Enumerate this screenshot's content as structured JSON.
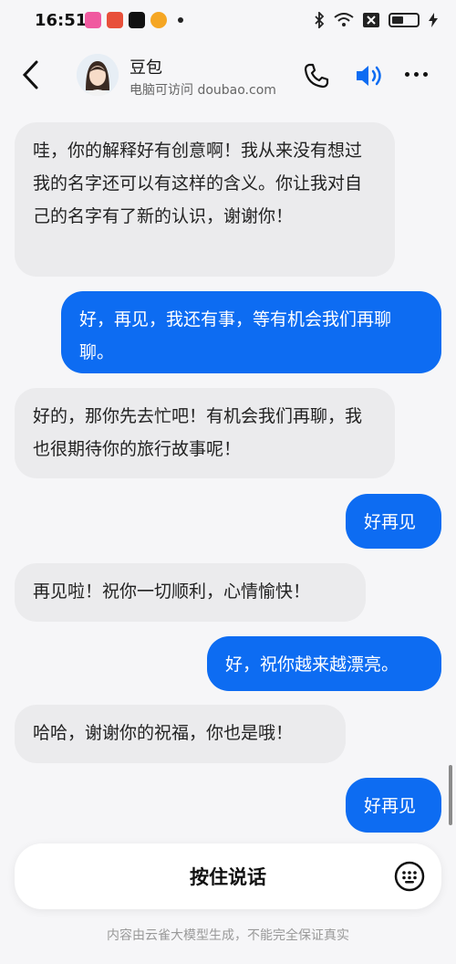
{
  "status_bar": {
    "time": "16:51"
  },
  "header": {
    "title": "豆包",
    "subtitle": "电脑可访问 doubao.com"
  },
  "messages": [
    {
      "role": "bot",
      "text": "哇，你的解释好有创意啊！我从来没有想过我的名字还可以有这样的含义。你让我对自己的名字有了新的认识，谢谢你！"
    },
    {
      "role": "user",
      "text": "好，再见，我还有事，等有机会我们再聊聊。"
    },
    {
      "role": "bot",
      "text": "好的，那你先去忙吧！有机会我们再聊，我也很期待你的旅行故事呢！"
    },
    {
      "role": "user",
      "text": "好再见"
    },
    {
      "role": "bot",
      "text": "再见啦！祝你一切顺利，心情愉快！"
    },
    {
      "role": "user",
      "text": "好，祝你越来越漂亮。"
    },
    {
      "role": "bot",
      "text": "哈哈，谢谢你的祝福，你也是哦！"
    },
    {
      "role": "user",
      "text": "好再见"
    }
  ],
  "input": {
    "hold_to_talk": "按住说话"
  },
  "footer": {
    "disclaimer": "内容由云雀大模型生成，不能完全保证真实"
  },
  "icons": [
    "back-arrow-icon",
    "phone-icon",
    "speaker-icon",
    "more-icon",
    "keyboard-icon"
  ],
  "colors": {
    "accent": "#0d6cf2",
    "bot_bubble": "#ebebed",
    "background": "#f6f6f8"
  }
}
